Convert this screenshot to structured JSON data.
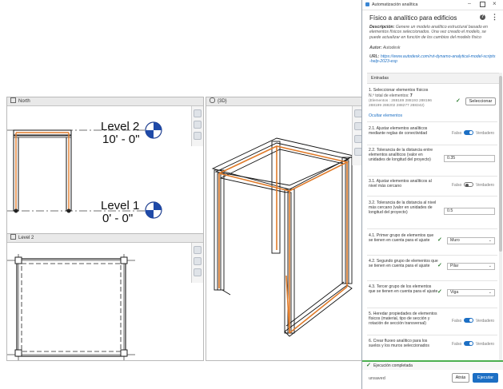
{
  "north_view": {
    "tab": "North"
  },
  "levels": [
    {
      "name": "Level 2",
      "elevation": "10' - 0\""
    },
    {
      "name": "Level 1",
      "elevation": "0' - 0\""
    }
  ],
  "plan_view": {
    "tab": "Level 2"
  },
  "view3d": {
    "tab": "{3D}"
  },
  "panel": {
    "window_title": "Automatización analítica",
    "title": "Físico a analítico para edificios",
    "description_label": "Descripción:",
    "description": "Genere un modelo analítico estructural basado en elementos físicos seleccionados. Una vez creado el modelo, se puede actualizar en función de los cambios del modelo físico",
    "author_label": "Autor:",
    "author": "Autodesk",
    "url_label": "URL:",
    "url": "https://www.autodesk.com/rvt-dynamo-analytical-model-scripts-help-2023-esp",
    "section": "Entradas",
    "step1": {
      "label": "1. Seleccionar elementos físicos",
      "count_label": "N.º total de elementos:",
      "count": "7",
      "ids": "(Elementos : 288189 288193 288196 288199 288202 288277 288342)",
      "button": "Seleccionar",
      "hide_link": "Ocultar elementos"
    },
    "rows": {
      "r21": {
        "label": "2.1. Ajustar elementos analíticos mediante reglas de conectividad",
        "off": "Falso",
        "on": "Verdadero"
      },
      "r22": {
        "label": "2.2. Tolerancia de la distancia entre elementos analíticos (valor en unidades de longitud del proyecto)",
        "value": "0.35"
      },
      "r31": {
        "label": "3.1. Ajustar elementos analíticos al nivel más cercano",
        "off": "Falso",
        "on": "Verdadero"
      },
      "r32": {
        "label": "3.2. Tolerancia de la distancia al nivel más cercano (valor en unidades de longitud del proyecto)",
        "value": "0.5"
      },
      "r41": {
        "label": "4.1. Primer grupo de elementos que se tienen en cuenta para el ajuste",
        "value": "Muro"
      },
      "r42": {
        "label": "4.2. Segundo grupo de elementos que se tienen en cuenta para el ajuste",
        "value": "Pilar"
      },
      "r43": {
        "label": "4.3. Tercer grupo de los elementos que se tienen en cuenta para el ajuste",
        "value": "Viga"
      },
      "r5": {
        "label": "5. Heredar propiedades de elementos físicos (material, tipo de sección y rotación de sección transversal)",
        "off": "Falso",
        "on": "Verdadero"
      },
      "r6": {
        "label": "6. Crear fluxeo analítico para los suelos y los muros seleccionados",
        "off": "Falso",
        "on": "Verdadero"
      }
    },
    "status": "Ejecución completada",
    "footer_state": "unsaved",
    "back_button": "Atrás",
    "run_button": "Ejecutar"
  }
}
